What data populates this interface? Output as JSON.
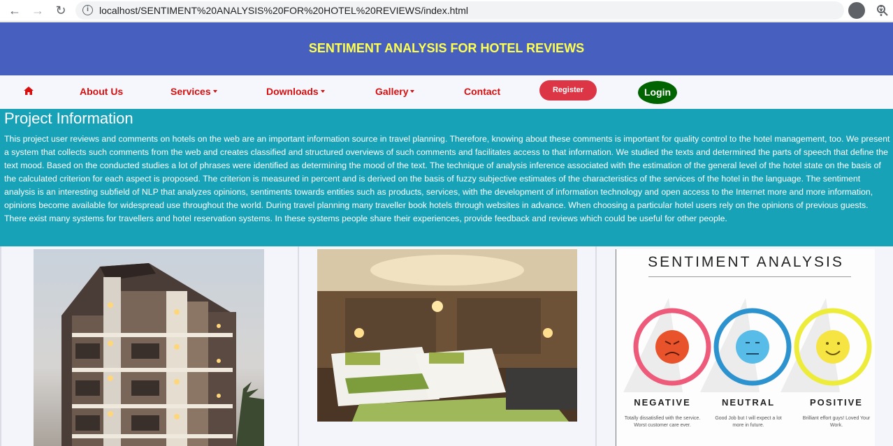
{
  "browser": {
    "url": "localhost/SENTIMENT%20ANALYSIS%20FOR%20HOTEL%20REVIEWS/index.html"
  },
  "banner": {
    "title": "SENTIMENT ANALYSIS FOR HOTEL REVIEWS"
  },
  "nav": {
    "items": [
      {
        "label": "About Us"
      },
      {
        "label": "Services"
      },
      {
        "label": "Downloads"
      },
      {
        "label": "Gallery"
      },
      {
        "label": "Contact"
      }
    ],
    "register_label": "Register",
    "login_label": "Login"
  },
  "project": {
    "heading": "Project Information",
    "body": "This project user reviews and comments on hotels on the web are an important information source in travel planning. Therefore, knowing about these comments is important for quality control to the hotel management, too. We present a system that collects such comments from the web and creates classified and structured overviews of such comments and facilitates access to that information. We studied the texts and determined the parts of speech that define the text mood. Based on the conducted studies a lot of phrases were identified as determining the mood of the text. The technique of analysis inference associated with the estimation of the general level of the hotel state on the basis of the calculated criterion for each aspect is proposed. The criterion is measured in percent and is derived on the basis of fuzzy subjective estimates of the characteristics of the services of the hotel in the language. The sentiment analysis is an interesting subfield of NLP that analyzes opinions, sentiments towards entities such as products, services, with the development of information technology and open access to the Internet more and more information, opinions become available for widespread use throughout the world. During travel planning many traveller book hotels through websites in advance. When choosing a particular hotel users rely on the opinions of previous guests. There exist many systems for travellers and hotel reservation systems. In these systems people share their experiences, provide feedback and reviews which could be useful for other people."
  },
  "gallery": {
    "sentiment_graphic": {
      "title": "SENTIMENT ANALYSIS",
      "negative": {
        "label": "NEGATIVE",
        "desc": "Totally dissatisfied with the service. Worst customer care ever."
      },
      "neutral": {
        "label": "NEUTRAL",
        "desc": "Good Job but I will expect a lot more in future."
      },
      "positive": {
        "label": "POSITIVE",
        "desc": "Brilliant effort guys! Loved Your Work."
      }
    }
  },
  "colors": {
    "banner": "#4760c0",
    "banner_title": "#ffff4d",
    "nav_link": "#d70f0f",
    "register": "#dc3545",
    "login": "#006400",
    "project_bg": "#17a2b8"
  }
}
